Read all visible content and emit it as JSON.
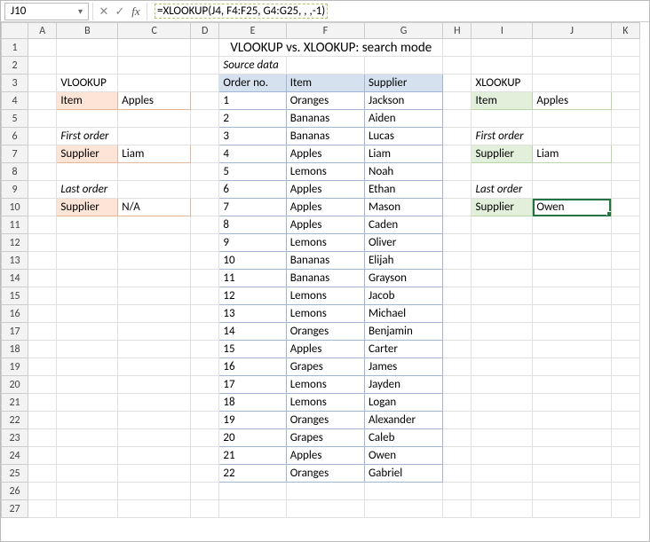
{
  "formula_bar": {
    "name_box": "J10",
    "formula": "=XLOOKUP(J4, F4:F25, G4:G25, , ,-1)"
  },
  "columns": [
    "A",
    "B",
    "C",
    "D",
    "E",
    "F",
    "G",
    "H",
    "I",
    "J",
    "K"
  ],
  "row_count": 27,
  "title": "VLOOKUP vs. XLOOKUP: search mode",
  "vlookup": {
    "heading": "VLOOKUP",
    "item_label": "Item",
    "item_value": "Apples",
    "first_order_label": "First order",
    "first_supplier_label": "Supplier",
    "first_supplier_value": "Liam",
    "last_order_label": "Last order",
    "last_supplier_label": "Supplier",
    "last_supplier_value": "N/A"
  },
  "xlookup": {
    "heading": "XLOOKUP",
    "item_label": "Item",
    "item_value": "Apples",
    "first_order_label": "First order",
    "first_supplier_label": "Supplier",
    "first_supplier_value": "Liam",
    "last_order_label": "Last order",
    "last_supplier_label": "Supplier",
    "last_supplier_value": "Owen"
  },
  "source": {
    "caption": "Source data",
    "headers": {
      "order": "Order no.",
      "item": "Item",
      "supplier": "Supplier"
    },
    "rows": [
      {
        "n": "1",
        "item": "Oranges",
        "sup": "Jackson"
      },
      {
        "n": "2",
        "item": "Bananas",
        "sup": "Aiden"
      },
      {
        "n": "3",
        "item": "Bananas",
        "sup": "Lucas"
      },
      {
        "n": "4",
        "item": "Apples",
        "sup": "Liam"
      },
      {
        "n": "5",
        "item": "Lemons",
        "sup": "Noah"
      },
      {
        "n": "6",
        "item": "Apples",
        "sup": "Ethan"
      },
      {
        "n": "7",
        "item": "Apples",
        "sup": "Mason"
      },
      {
        "n": "8",
        "item": "Apples",
        "sup": "Caden"
      },
      {
        "n": "9",
        "item": "Lemons",
        "sup": "Oliver"
      },
      {
        "n": "10",
        "item": "Bananas",
        "sup": "Elijah"
      },
      {
        "n": "11",
        "item": "Bananas",
        "sup": "Grayson"
      },
      {
        "n": "12",
        "item": "Lemons",
        "sup": "Jacob"
      },
      {
        "n": "13",
        "item": "Lemons",
        "sup": "Michael"
      },
      {
        "n": "14",
        "item": "Oranges",
        "sup": "Benjamin"
      },
      {
        "n": "15",
        "item": "Apples",
        "sup": "Carter"
      },
      {
        "n": "16",
        "item": "Grapes",
        "sup": "James"
      },
      {
        "n": "17",
        "item": "Lemons",
        "sup": "Jayden"
      },
      {
        "n": "18",
        "item": "Lemons",
        "sup": "Logan"
      },
      {
        "n": "19",
        "item": "Oranges",
        "sup": "Alexander"
      },
      {
        "n": "20",
        "item": "Grapes",
        "sup": "Caleb"
      },
      {
        "n": "21",
        "item": "Apples",
        "sup": "Owen"
      },
      {
        "n": "22",
        "item": "Oranges",
        "sup": "Gabriel"
      }
    ]
  },
  "active_cell": {
    "col": "J",
    "row": 10
  }
}
